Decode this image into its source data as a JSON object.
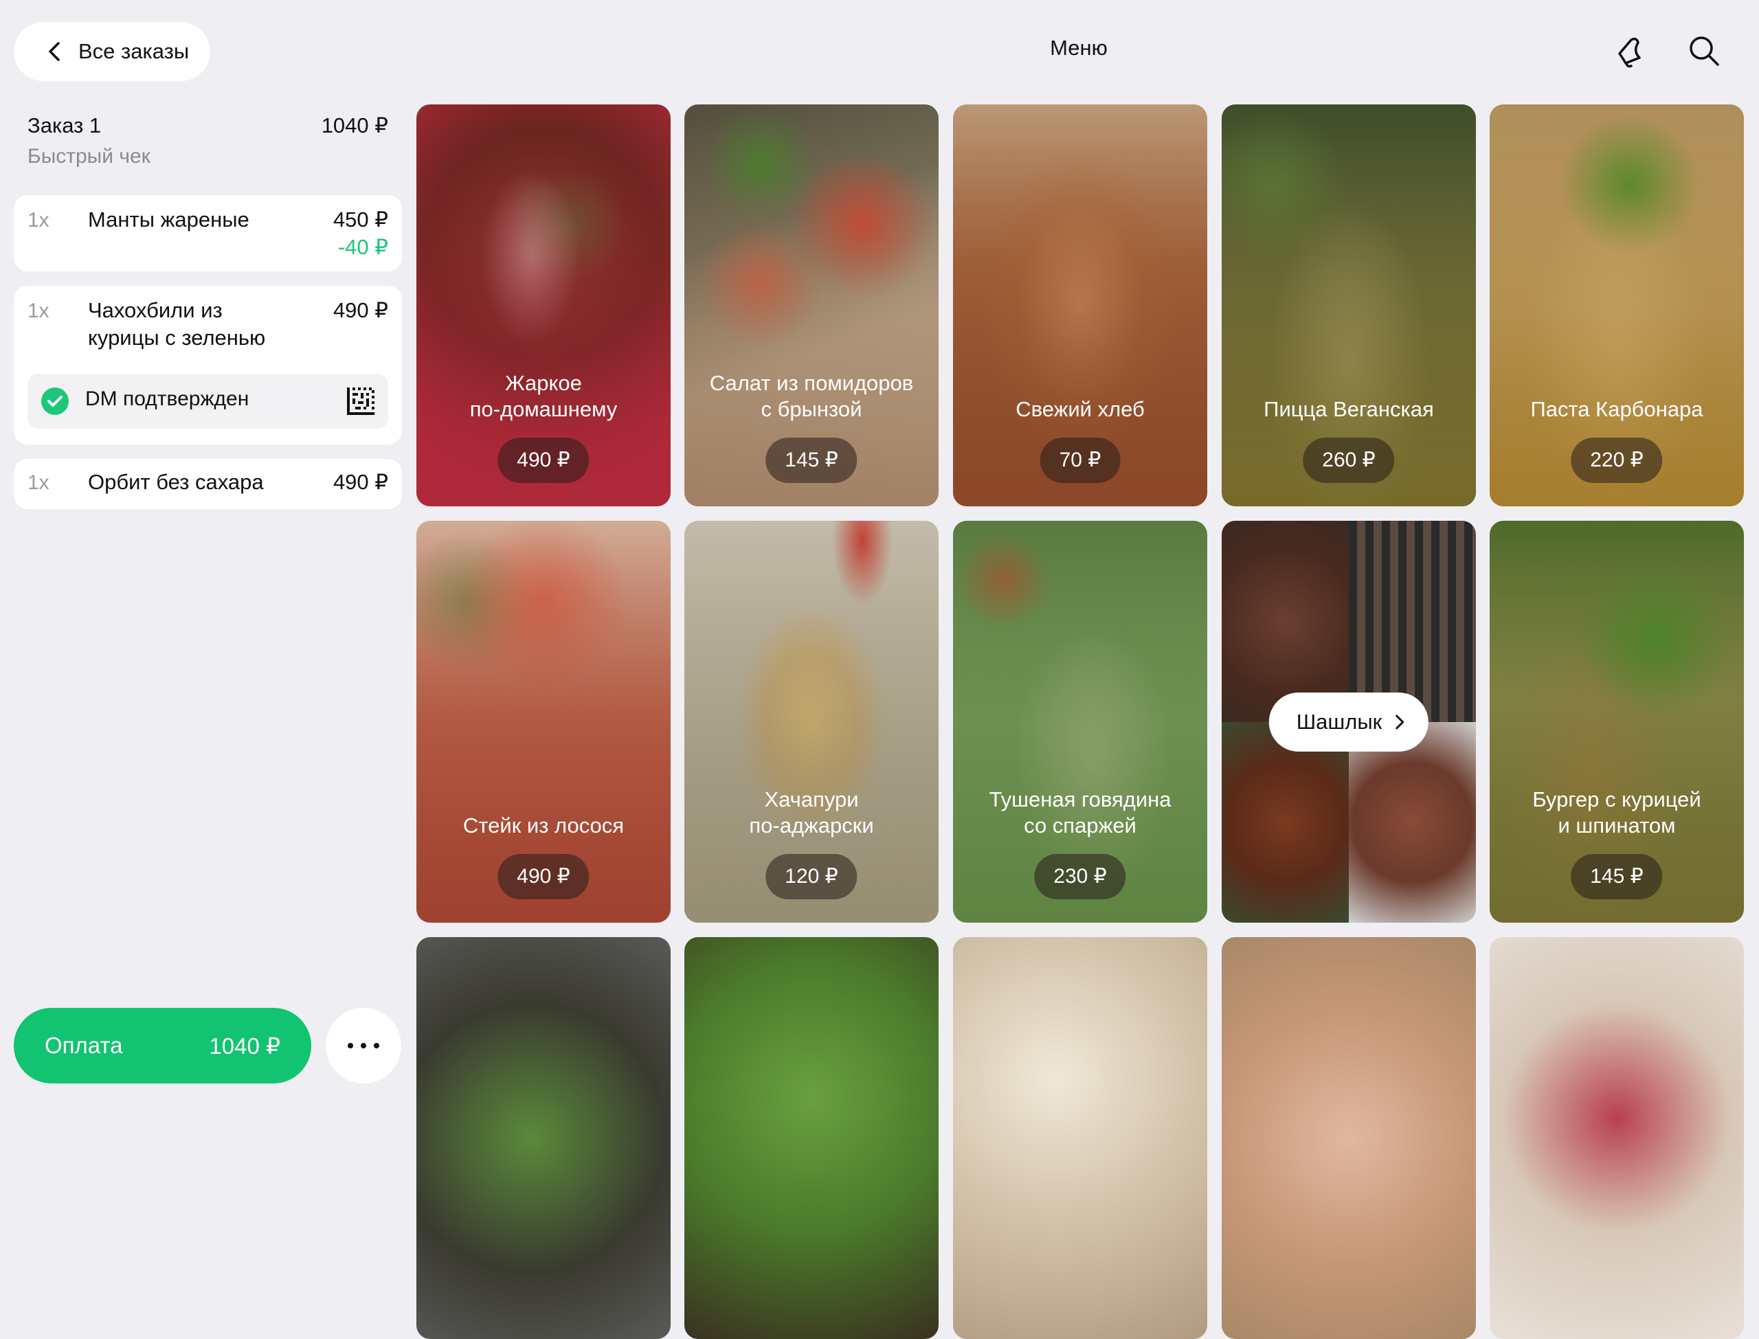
{
  "header": {
    "back_label": "Все заказы",
    "title": "Меню"
  },
  "order": {
    "title": "Заказ 1",
    "subtitle": "Быстрый чек",
    "total": "1040 ₽",
    "items": [
      {
        "qty": "1x",
        "name": "Манты жареные",
        "price": "450 ₽",
        "discount": "-40 ₽"
      },
      {
        "qty": "1x",
        "name": "Чахохбили из курицы с зеленью",
        "price": "490 ₽",
        "dm_status": "DM подтвержден"
      },
      {
        "qty": "1x",
        "name": "Орбит без сахара",
        "price": "490 ₽"
      }
    ]
  },
  "footer": {
    "pay_label": "Оплата",
    "pay_total": "1040 ₽"
  },
  "menu": [
    {
      "name": "Жаркое\nпо-домашнему",
      "price": "490 ₽"
    },
    {
      "name": "Салат из помидоров\nс брынзой",
      "price": "145 ₽"
    },
    {
      "name": "Свежий хлеб",
      "price": "70 ₽"
    },
    {
      "name": "Пицца Веганская",
      "price": "260 ₽"
    },
    {
      "name": "Паста Карбонара",
      "price": "220 ₽"
    },
    {
      "name": "Стейк из лосося",
      "price": "490 ₽"
    },
    {
      "name": "Хачапури\nпо-аджарски",
      "price": "120 ₽"
    },
    {
      "name": "Тушеная говядина\nсо спаржей",
      "price": "230 ₽"
    },
    {
      "category": "Шашлык"
    },
    {
      "name": "Бургер с курицей\nи шпинатом",
      "price": "145 ₽"
    }
  ],
  "colors": {
    "accent": "#12c371",
    "discount": "#1dc77a",
    "background": "#efeef3"
  },
  "icons": [
    "chevron-left-icon",
    "bell-icon",
    "search-icon",
    "check-circle-icon",
    "datamatrix-icon",
    "more-icon",
    "chevron-right-icon"
  ]
}
